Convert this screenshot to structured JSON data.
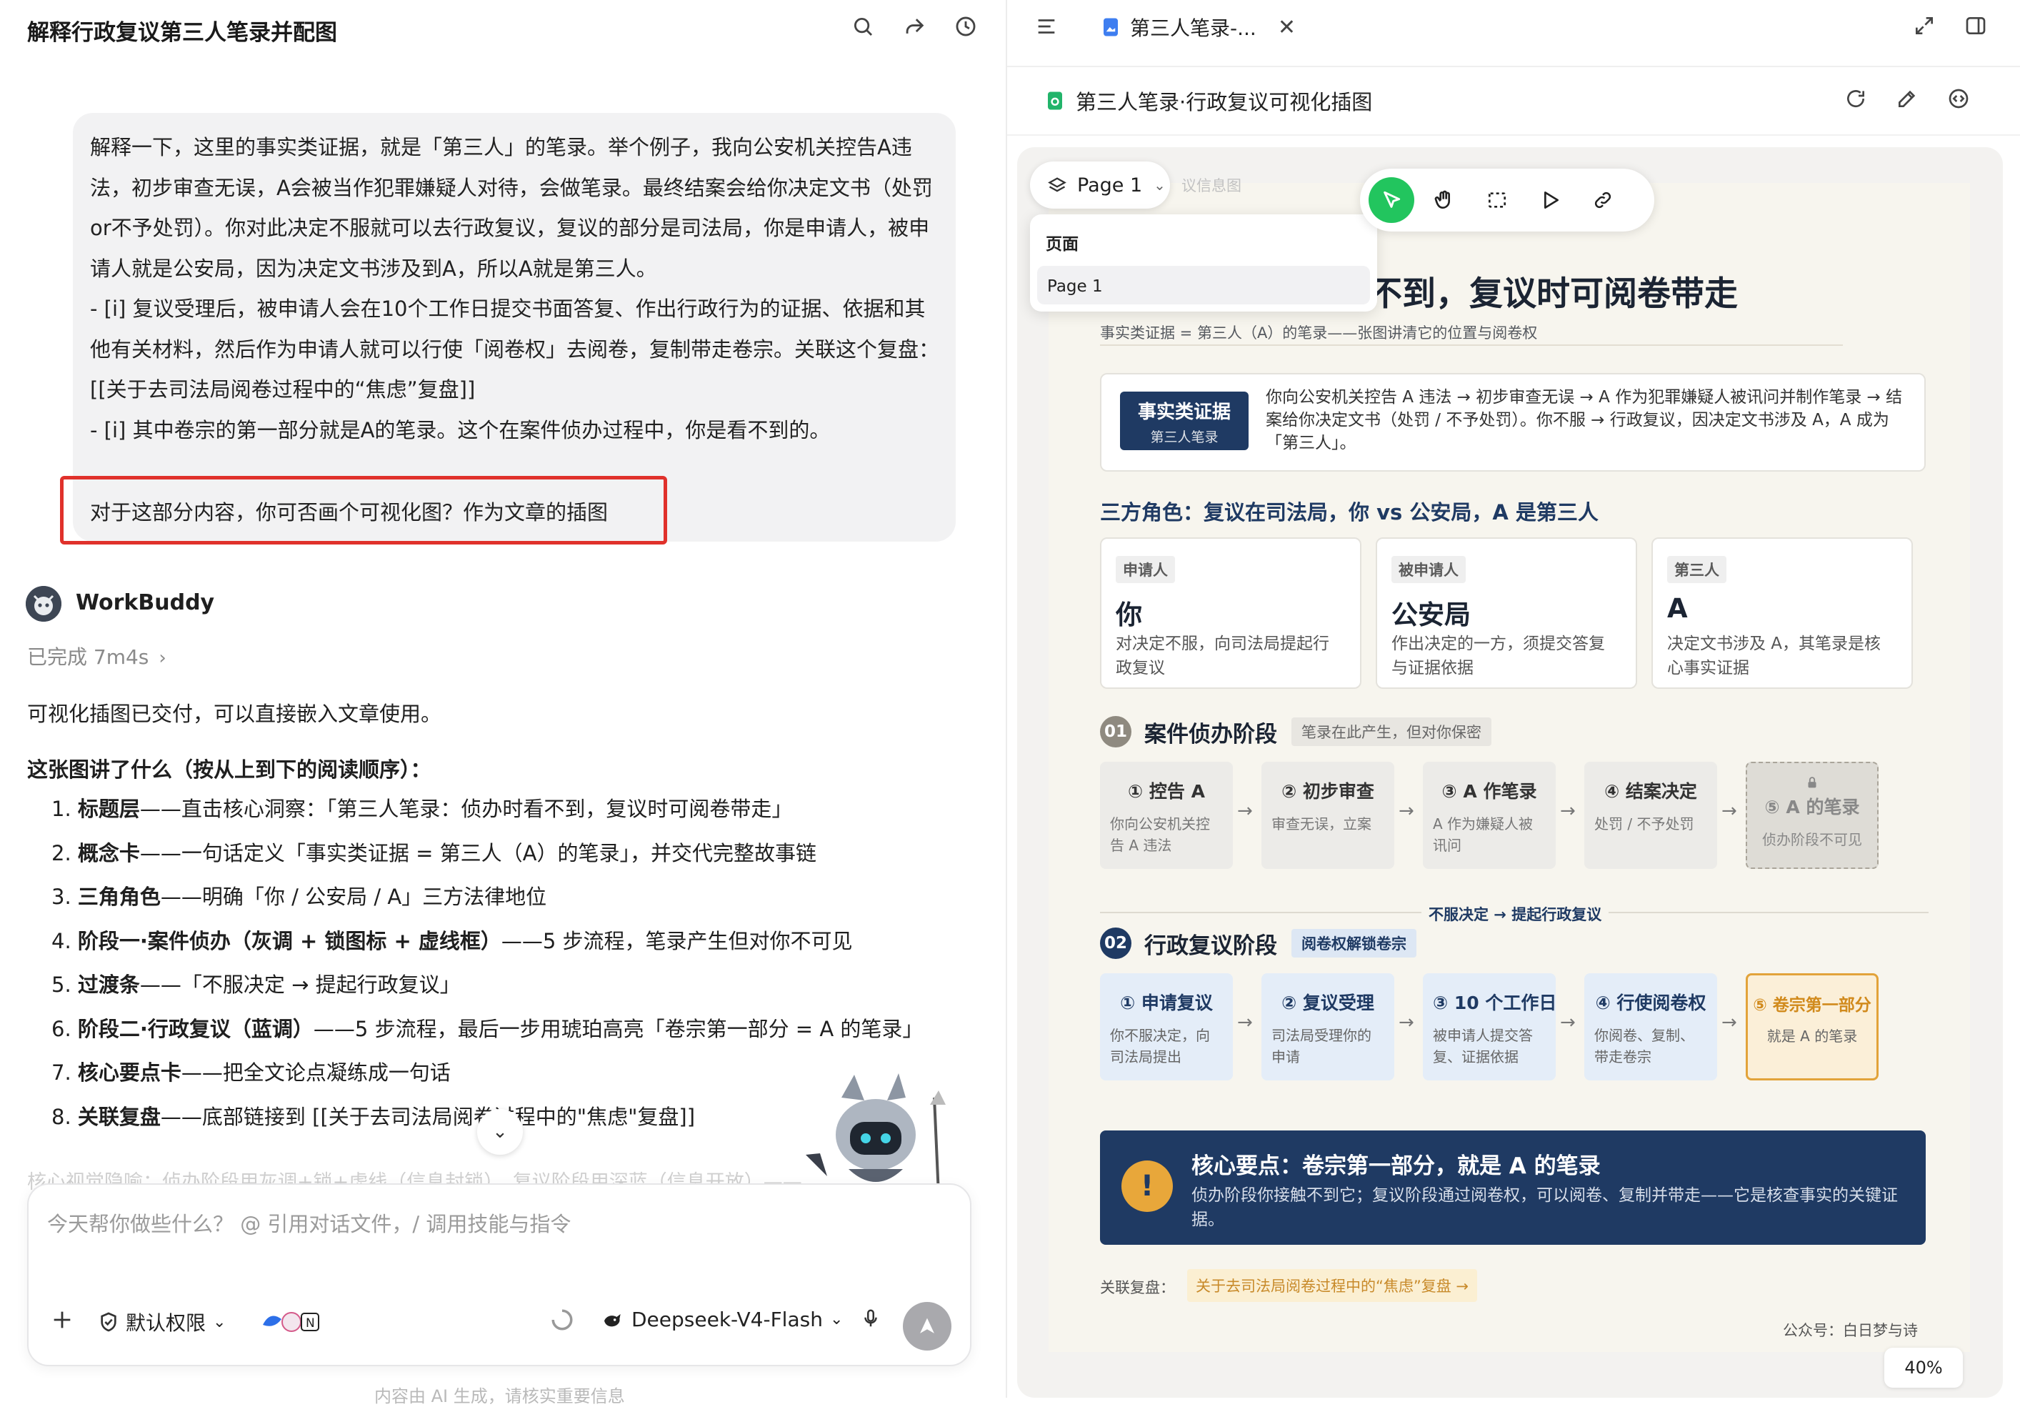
{
  "left": {
    "title": "解释行政复议第三人笔录并配图",
    "user_message": {
      "paragraphs": [
        "解释一下，这里的事实类证据，就是「第三人」的笔录。举个例子，我向公安机关控告A违法，初步审查无误，A会被当作犯罪嫌疑人对待，会做笔录。最终结案会给你决定文书（处罚or不予处罚）。你对此决定不服就可以去行政复议，复议的部分是司法局，你是申请人，被申请人就是公安局，因为决定文书涉及到A，所以A就是第三人。",
        "- [i] 复议受理后，被申请人会在10个工作日提交书面答复、作出行政行为的证据、依据和其他有关材料，然后作为申请人就可以行使「阅卷权」去阅卷，复制带走卷宗。关联这个复盘：[[关于去司法局阅卷过程中的“焦虑”复盘]]",
        "- [i] 其中卷宗的第一部分就是A的笔录。这个在案件侦办过程中，你是看不到的。"
      ],
      "ask": "对于这部分内容，你可否画个可视化图？作为文章的插图"
    },
    "assistant": {
      "name": "WorkBuddy",
      "status": "已完成 7m4s",
      "intro": "可视化插图已交付，可以直接嵌入文章使用。",
      "heading": "这张图讲了什么（按从上到下的阅读顺序）：",
      "items": [
        {
          "num": "1.",
          "bold": "标题层",
          "text": "——直击核心洞察：「第三人笔录：侦办时看不到，复议时可阅卷带走」"
        },
        {
          "num": "2.",
          "bold": "概念卡",
          "text": "——一句话定义「事实类证据 = 第三人（A）的笔录」，并交代完整故事链"
        },
        {
          "num": "3.",
          "bold": "三角角色",
          "text": "——明确「你 / 公安局 / A」三方法律地位"
        },
        {
          "num": "4.",
          "bold": "阶段一·案件侦办（灰调 + 锁图标 + 虚线框）",
          "text": "——5 步流程，笔录产生但对你不可见"
        },
        {
          "num": "5.",
          "bold": "过渡条",
          "text": "——「不服决定 → 提起行政复议」"
        },
        {
          "num": "6.",
          "bold": "阶段二·行政复议（蓝调）",
          "text": "——5 步流程，最后一步用琥珀高亮「卷宗第一部分 = A 的笔录」"
        },
        {
          "num": "7.",
          "bold": "核心要点卡",
          "text": "——把全文论点凝练成一句话"
        },
        {
          "num": "8.",
          "bold": "关联复盘",
          "text": "——底部链接到 [[关于去司法局阅卷过程中的\"焦虑\"复盘]]"
        }
      ],
      "faded": "核心视觉隐喻：侦办阶段用灰调+锁+虚线（信息封锁），复议阶段用深蓝（信息开放）——"
    },
    "input": {
      "placeholder": "今天帮你做些什么？ @ 引用对话文件，/ 调用技能与指令",
      "permission": "默认权限",
      "model": "Deepseek-V4-Flash"
    },
    "footnote": "内容由 AI 生成，请核实重要信息"
  },
  "right": {
    "tab_label": "第三人笔录-...",
    "doc_title": "第三人笔录·行政复议可视化插图",
    "page_selector": "Page 1",
    "page_menu": {
      "header": "页面",
      "items": [
        "Page 1"
      ]
    },
    "zoom": "40%",
    "poster": {
      "ghost_text": "议信息图",
      "title": "时看不到，复议时可阅卷带走",
      "subtitle": "事实类证据 = 第三人（A）的笔录——张图讲清它的位置与阅卷权",
      "concept": {
        "badge_title": "事实类证据",
        "badge_sub": "第三人笔录",
        "text": "你向公安机关控告 A 违法 → 初步审查无误 → A 作为犯罪嫌疑人被讯问并制作笔录 → 结案给你决定文书（处罚 / 不予处罚）。你不服 → 行政复议，因决定文书涉及 A，A 成为「第三人」。"
      },
      "roles_title": "三方角色：复议在司法局，你 vs 公安局，A 是第三人",
      "roles": [
        {
          "tag": "申请人",
          "name": "你",
          "desc": "对决定不服，向司法局提起行政复议"
        },
        {
          "tag": "被申请人",
          "name": "公安局",
          "desc": "作出决定的一方，须提交答复与证据依据"
        },
        {
          "tag": "第三人",
          "name": "A",
          "desc": "决定文书涉及 A，其笔录是核心事实证据"
        }
      ],
      "stage1": {
        "num": "01",
        "title": "案件侦办阶段",
        "tag": "笔录在此产生，但对你保密",
        "steps": [
          {
            "title": "① 控告 A",
            "desc": "你向公安机关控告 A 违法"
          },
          {
            "title": "② 初步审查",
            "desc": "审查无误，立案"
          },
          {
            "title": "③ A 作笔录",
            "desc": "A 作为嫌疑人被讯问"
          },
          {
            "title": "④ 结案决定",
            "desc": "处罚 / 不予处罚"
          },
          {
            "title": "⑤ A 的笔录",
            "desc": "侦办阶段不可见"
          }
        ]
      },
      "transition": "不服决定 → 提起行政复议",
      "stage2": {
        "num": "02",
        "title": "行政复议阶段",
        "tag": "阅卷权解锁卷宗",
        "steps": [
          {
            "title": "① 申请复议",
            "desc": "你不服决定，向司法局提出"
          },
          {
            "title": "② 复议受理",
            "desc": "司法局受理你的申请"
          },
          {
            "title": "③ 10 个工作日",
            "desc": "被申请人提交答复、证据依据"
          },
          {
            "title": "④ 行使阅卷权",
            "desc": "你阅卷、复制、带走卷宗"
          },
          {
            "title": "⑤ 卷宗第一部分",
            "desc": "就是 A 的笔录"
          }
        ]
      },
      "core": {
        "icon": "!",
        "title": "核心要点：卷宗第一部分，就是 A 的笔录",
        "desc": "侦办阶段你接触不到它；复议阶段通过阅卷权，可以阅卷、复制并带走——它是核查事实的关键证据。"
      },
      "review_label": "关联复盘：",
      "review_link": "关于去司法局阅卷过程中的“焦虑”复盘 →",
      "signature": "公众号：白日梦与诗"
    }
  },
  "colors": {
    "navy": "#1f3a63",
    "amber": "#e2a33a",
    "highlight_red": "#e0312b",
    "green_tool": "#22c55e"
  }
}
